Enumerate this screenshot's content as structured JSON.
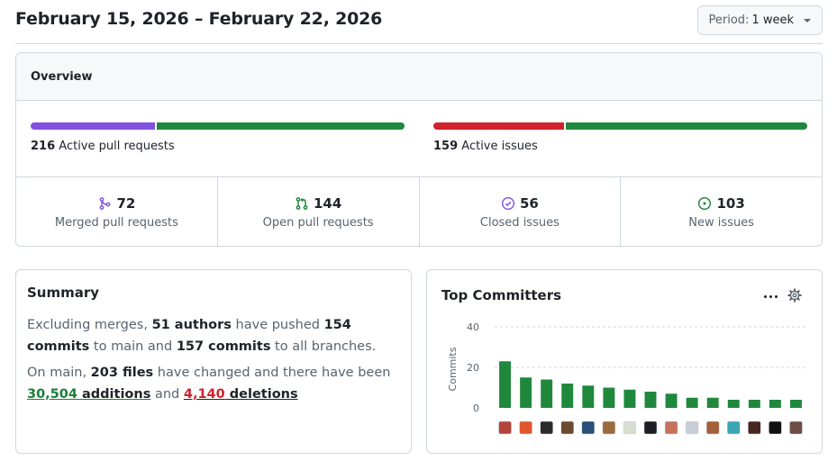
{
  "header": {
    "date_range": "February 15, 2026 – February 22, 2026",
    "period_label": "Period:",
    "period_value": "1 week"
  },
  "overview": {
    "title": "Overview",
    "pull_requests": {
      "count": "216",
      "label": "Active pull requests",
      "merged_fraction": 0.333,
      "colors": [
        "#8250df",
        "#1f883d"
      ]
    },
    "issues": {
      "count": "159",
      "label": "Active issues",
      "closed_fraction": 0.352,
      "colors": [
        "#cf222e",
        "#1f883d"
      ]
    },
    "stats": [
      {
        "icon": "git-merge-icon",
        "value": "72",
        "label": "Merged pull requests",
        "color": "#8250df"
      },
      {
        "icon": "git-pull-request-icon",
        "value": "144",
        "label": "Open pull requests",
        "color": "#1a7f37"
      },
      {
        "icon": "issue-closed-icon",
        "value": "56",
        "label": "Closed issues",
        "color": "#8250df"
      },
      {
        "icon": "issue-opened-icon",
        "value": "103",
        "label": "New issues",
        "color": "#1a7f37"
      }
    ]
  },
  "summary": {
    "title": "Summary",
    "t1": "Excluding merges, ",
    "authors": "51 authors",
    "t2": " have pushed ",
    "commits_main": "154 commits",
    "t3": " to main and ",
    "commits_all": "157 commits",
    "t4": " to all branches.",
    "t5": "On main, ",
    "files": "203 files",
    "t6": " have changed and there have been ",
    "additions_num": "30,504",
    "additions_word": " additions",
    "t7": " and ",
    "deletions_num": "4,140",
    "deletions_word": " deletions"
  },
  "top_committers": {
    "title": "Top Committers",
    "chart_data": {
      "type": "bar",
      "ylabel": "Commits",
      "ylim": [
        0,
        40
      ],
      "yticks": [
        "40",
        "20",
        "0"
      ],
      "grid": true,
      "bar_color": "#1f883d",
      "values": [
        23,
        15,
        14,
        12,
        11,
        10,
        9,
        8,
        7,
        5,
        5,
        4,
        4,
        4,
        4
      ],
      "avatar_colors": [
        "#b5443c",
        "#e2572f",
        "#2b2b2b",
        "#6b4a2e",
        "#2a4f7a",
        "#9a6b3f",
        "#d9dcd0",
        "#1e1e24",
        "#c7715c",
        "#c8ced6",
        "#a3603a",
        "#3aa5b5",
        "#4a2620",
        "#111111",
        "#6f4d43"
      ]
    }
  }
}
